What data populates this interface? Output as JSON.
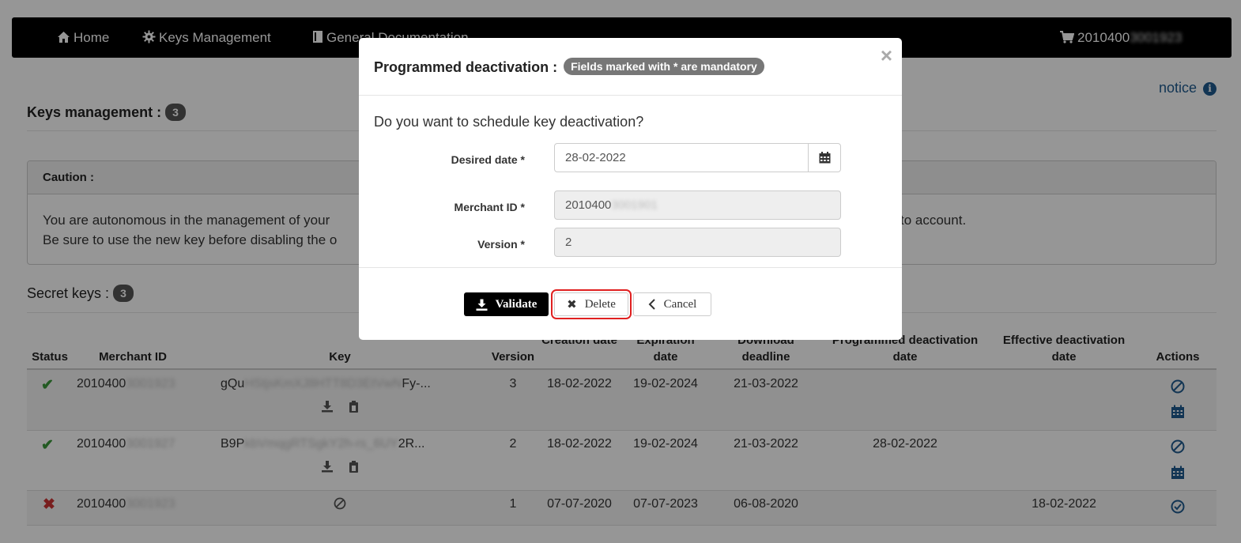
{
  "navbar": {
    "home": "Home",
    "keys_management": "Keys Management",
    "general_documentation": "General Documentation",
    "merchant_visible": "2010400",
    "merchant_blurred": "3001923"
  },
  "page": {
    "notice": "notice",
    "keys_title": "Keys management :",
    "keys_count": "3",
    "caution_title": "Caution :",
    "caution_line1": "You are autonomous in the management of your",
    "caution_line1_end": "to account.",
    "caution_line2": "Be sure to use the new key before disabling the o",
    "secret_title": "Secret keys :",
    "secret_count": "3"
  },
  "table": {
    "headers": {
      "status": "Status",
      "merchant_id": "Merchant ID",
      "key": "Key",
      "version": "Version",
      "creation": "Creation date",
      "expiration": "Expiration date",
      "download": "Download deadline",
      "programmed": "Programmed deactivation date",
      "effective": "Effective deactivation date",
      "actions": "Actions"
    },
    "rows": [
      {
        "status": "active",
        "merchant_visible": "2010400",
        "merchant_blurred": "3001923",
        "key_start": "gQu",
        "key_blurred": "HStjsKmXJ8HTT8D3EtVwN",
        "key_end": "Fy-...",
        "version": "3",
        "creation": "18-02-2022",
        "expiration": "19-02-2024",
        "download": "21-03-2022",
        "programmed": "",
        "effective": ""
      },
      {
        "status": "active",
        "merchant_visible": "2010400",
        "merchant_blurred": "3001927",
        "key_start": "B9P",
        "key_blurred": "kbVmqgRTSgkY2h-rs_6UY",
        "key_end": "2R...",
        "version": "2",
        "creation": "18-02-2022",
        "expiration": "19-02-2024",
        "download": "21-03-2022",
        "programmed": "28-02-2022",
        "effective": ""
      },
      {
        "status": "inactive",
        "merchant_visible": "2010400",
        "merchant_blurred": "3001923",
        "key_start": "",
        "key_blurred": "",
        "key_end": "",
        "version": "1",
        "creation": "07-07-2020",
        "expiration": "07-07-2023",
        "download": "06-08-2020",
        "programmed": "",
        "effective": "18-02-2022"
      }
    ]
  },
  "modal": {
    "title": "Programmed deactivation :",
    "mandatory_badge": "Fields marked with * are mandatory",
    "close": "×",
    "question": "Do you want to schedule key deactivation?",
    "desired_date_label": "Desired date *",
    "desired_date_value": "28-02-2022",
    "merchant_id_label": "Merchant ID *",
    "merchant_id_visible": "2010400",
    "merchant_id_blurred": "3001901",
    "version_label": "Version *",
    "version_value": "2",
    "validate": "Validate",
    "delete": "Delete",
    "cancel": "Cancel"
  },
  "colors": {
    "navbar": "#000000",
    "link": "#1f5b8f",
    "check": "#3c9a3c",
    "cross": "#cc3333",
    "highlight": "#e02020"
  }
}
